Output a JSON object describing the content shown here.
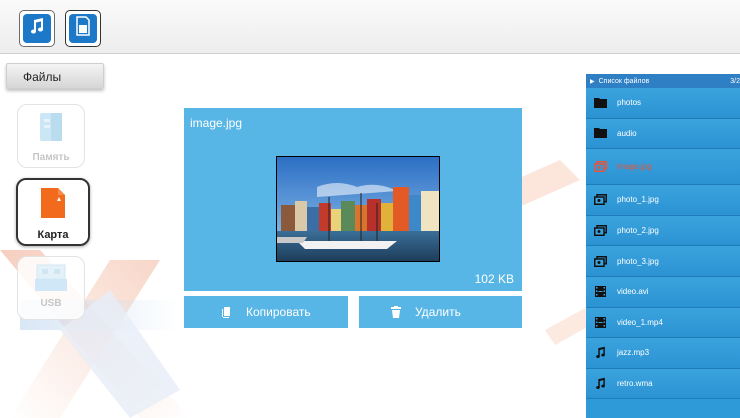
{
  "top_buttons": [
    {
      "name": "music-tab",
      "icon": "music-note-icon"
    },
    {
      "name": "sd-card-tab",
      "icon": "sd-card-icon"
    }
  ],
  "files_tab": {
    "label": "Файлы"
  },
  "storage": [
    {
      "label": "Память",
      "icon": "internal-memory-icon",
      "state": "disabled"
    },
    {
      "label": "Карта",
      "icon": "sd-card-icon",
      "state": "active"
    },
    {
      "label": "USB",
      "icon": "usb-icon",
      "state": "disabled"
    }
  ],
  "preview": {
    "filename": "image.jpg",
    "size": "102 KB"
  },
  "actions": {
    "copy_label": "Копировать",
    "delete_label": "Удалить"
  },
  "file_list": {
    "title": "Список файлов",
    "count": "3/2",
    "items": [
      {
        "label": "photos",
        "icon": "folder-icon"
      },
      {
        "label": "audio",
        "icon": "folder-icon"
      },
      {
        "label": "image.jpg",
        "icon": "image-icon",
        "selected": true
      },
      {
        "label": "photo_1.jpg",
        "icon": "image-icon"
      },
      {
        "label": "photo_2.jpg",
        "icon": "image-icon"
      },
      {
        "label": "photo_3.jpg",
        "icon": "image-icon"
      },
      {
        "label": "video.avi",
        "icon": "film-icon"
      },
      {
        "label": "video_1.mp4",
        "icon": "film-icon"
      },
      {
        "label": "jazz.mp3",
        "icon": "music-note-icon"
      },
      {
        "label": "retro.wma",
        "icon": "music-note-icon"
      }
    ]
  },
  "colors": {
    "accent": "#58b6e6",
    "list_bg": "#2f9ad8",
    "selected_text": "#e8533a",
    "sd_orange": "#f26a1b"
  }
}
